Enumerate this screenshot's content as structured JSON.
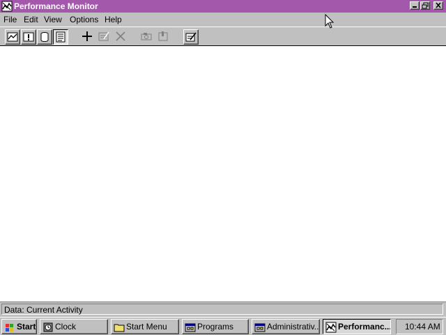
{
  "window": {
    "title": "Performance Monitor",
    "title_bar_color": "#a458ac",
    "app_icon": "performance-monitor-icon",
    "controls": [
      "minimize-icon",
      "restore-icon",
      "close-icon"
    ]
  },
  "menu": {
    "items": [
      {
        "label": "File"
      },
      {
        "label": "Edit"
      },
      {
        "label": "View"
      },
      {
        "label": "Options"
      },
      {
        "label": "Help"
      }
    ]
  },
  "toolbar": {
    "buttons": [
      {
        "icon": "chart-view-icon",
        "pressed": false
      },
      {
        "icon": "alert-view-icon",
        "pressed": false
      },
      {
        "icon": "log-view-icon",
        "pressed": false
      },
      {
        "icon": "report-view-icon",
        "pressed": true
      },
      {
        "icon": "add-counter-icon",
        "enabled": true
      },
      {
        "icon": "edit-counter-icon",
        "enabled": false
      },
      {
        "icon": "delete-counter-icon",
        "enabled": false
      },
      {
        "icon": "update-now-icon",
        "enabled": false
      },
      {
        "icon": "bookmark-icon",
        "enabled": false
      },
      {
        "icon": "options-icon",
        "enabled": true
      }
    ]
  },
  "status": {
    "text": "Data: Current Activity"
  },
  "taskbar": {
    "start_label": "Start",
    "buttons": [
      {
        "label": "Clock",
        "icon": "clock-icon",
        "active": false
      },
      {
        "label": "Start Menu",
        "icon": "folder-icon",
        "active": false
      },
      {
        "label": "Programs",
        "icon": "program-group-icon",
        "active": false
      },
      {
        "label": "Administrativ...",
        "icon": "program-group-icon",
        "active": false
      },
      {
        "label": "Performanc...",
        "icon": "performance-monitor-icon",
        "active": true
      }
    ],
    "clock": "10:44 AM"
  }
}
